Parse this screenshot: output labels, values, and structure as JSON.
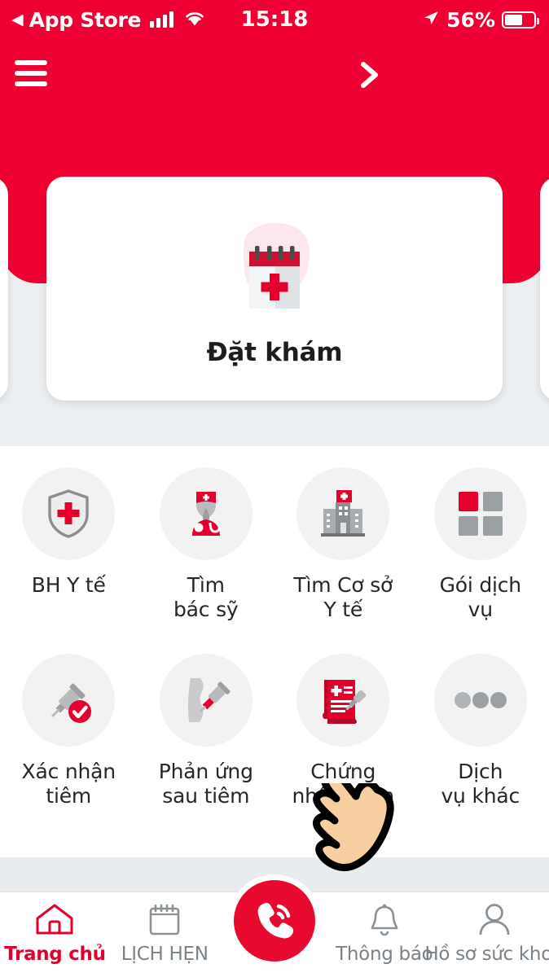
{
  "status_bar": {
    "back_label": "App Store",
    "back_arrow": "back-triangle-icon",
    "signal_icon": "signal-bars-icon",
    "wifi_icon": "wifi-icon",
    "time": "15:18",
    "location_icon": "location-arrow-icon",
    "battery_percent": "56%",
    "battery_icon": "battery-icon"
  },
  "header": {
    "menu_icon": "hamburger-menu-icon",
    "next_icon": "chevron-right-icon",
    "background_color": "#ef0032"
  },
  "carousel": {
    "active_card": {
      "label": "Đặt khám",
      "icon": "calendar-medical-icon"
    }
  },
  "services": {
    "row1": [
      {
        "label": "BH Y tế",
        "icon": "shield-cross-icon"
      },
      {
        "label": "Tìm\nbác sỹ",
        "icon": "doctor-icon"
      },
      {
        "label": "Tìm Cơ sở\nY tế",
        "icon": "hospital-building-icon"
      },
      {
        "label": "Gói dịch\nvụ",
        "icon": "grid-squares-icon"
      }
    ],
    "row2": [
      {
        "label": "Xác nhận\ntiêm",
        "icon": "syringe-check-icon"
      },
      {
        "label": "Phản ứng\nsau tiêm",
        "icon": "arm-injection-icon"
      },
      {
        "label": "Chứng\nnhận tiêm",
        "icon": "certificate-syringe-icon"
      },
      {
        "label": "Dịch\nvụ khác",
        "icon": "three-dots-icon"
      }
    ]
  },
  "tabbar": {
    "items": [
      {
        "label": "Trang chủ",
        "icon": "home-icon",
        "active": true
      },
      {
        "label": "LỊCH HẸN",
        "icon": "calendar-icon",
        "active": false
      },
      {
        "label": "Thông báo",
        "icon": "bell-icon",
        "active": false
      },
      {
        "label": "Hồ sơ sức khoẻ",
        "icon": "person-icon",
        "active": false
      }
    ],
    "fab": {
      "icon": "phone-call-icon",
      "color": "#e8092f"
    }
  },
  "cursor": {
    "icon": "pointing-hand-cursor"
  },
  "colors": {
    "brand_red": "#ef0032",
    "accent_red": "#e3002c",
    "page_bg": "#eceff1"
  }
}
